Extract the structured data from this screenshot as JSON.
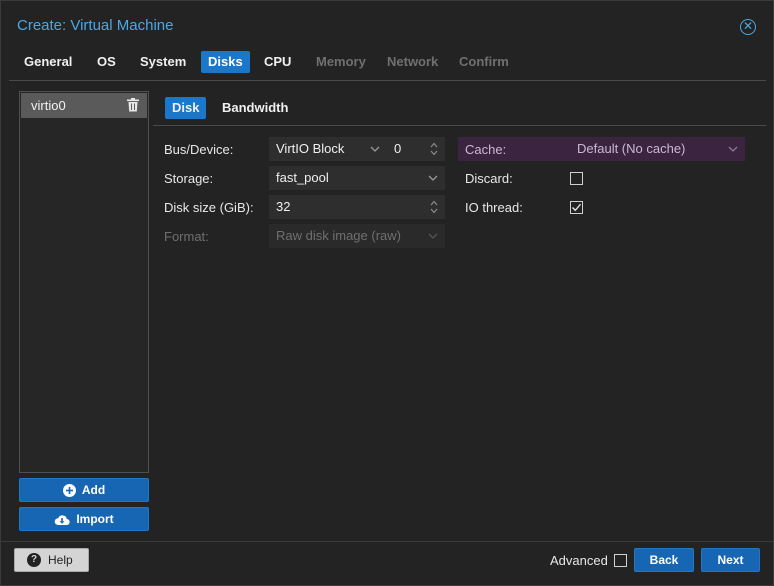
{
  "window": {
    "title": "Create: Virtual Machine",
    "close_glyph": "✕"
  },
  "tabs": [
    {
      "label": "General",
      "state": "normal"
    },
    {
      "label": "OS",
      "state": "normal"
    },
    {
      "label": "System",
      "state": "normal"
    },
    {
      "label": "Disks",
      "state": "active"
    },
    {
      "label": "CPU",
      "state": "normal"
    },
    {
      "label": "Memory",
      "state": "disabled"
    },
    {
      "label": "Network",
      "state": "disabled"
    },
    {
      "label": "Confirm",
      "state": "disabled"
    }
  ],
  "disk_list": {
    "items": [
      {
        "label": "virtio0",
        "icon": "trash-icon"
      }
    ]
  },
  "left_buttons": {
    "add": "Add",
    "import": "Import"
  },
  "subtabs": [
    {
      "label": "Disk",
      "state": "active"
    },
    {
      "label": "Bandwidth",
      "state": "normal"
    }
  ],
  "form": {
    "bus_device": {
      "label": "Bus/Device:",
      "bus": "VirtIO Block",
      "device": "0"
    },
    "storage": {
      "label": "Storage:",
      "value": "fast_pool"
    },
    "disk_size": {
      "label": "Disk size (GiB):",
      "value": "32"
    },
    "format": {
      "label": "Format:",
      "value": "Raw disk image (raw)"
    },
    "cache": {
      "label": "Cache:",
      "value": "Default (No cache)"
    },
    "discard": {
      "label": "Discard:",
      "checked": false
    },
    "io_thread": {
      "label": "IO thread:",
      "checked": true
    }
  },
  "footer": {
    "help": "Help",
    "advanced": "Advanced",
    "advanced_checked": false,
    "back": "Back",
    "next": "Next"
  },
  "colors": {
    "accent": "#1a77c9",
    "title": "#4aa8e8",
    "cache_highlight": "#3b2440"
  }
}
